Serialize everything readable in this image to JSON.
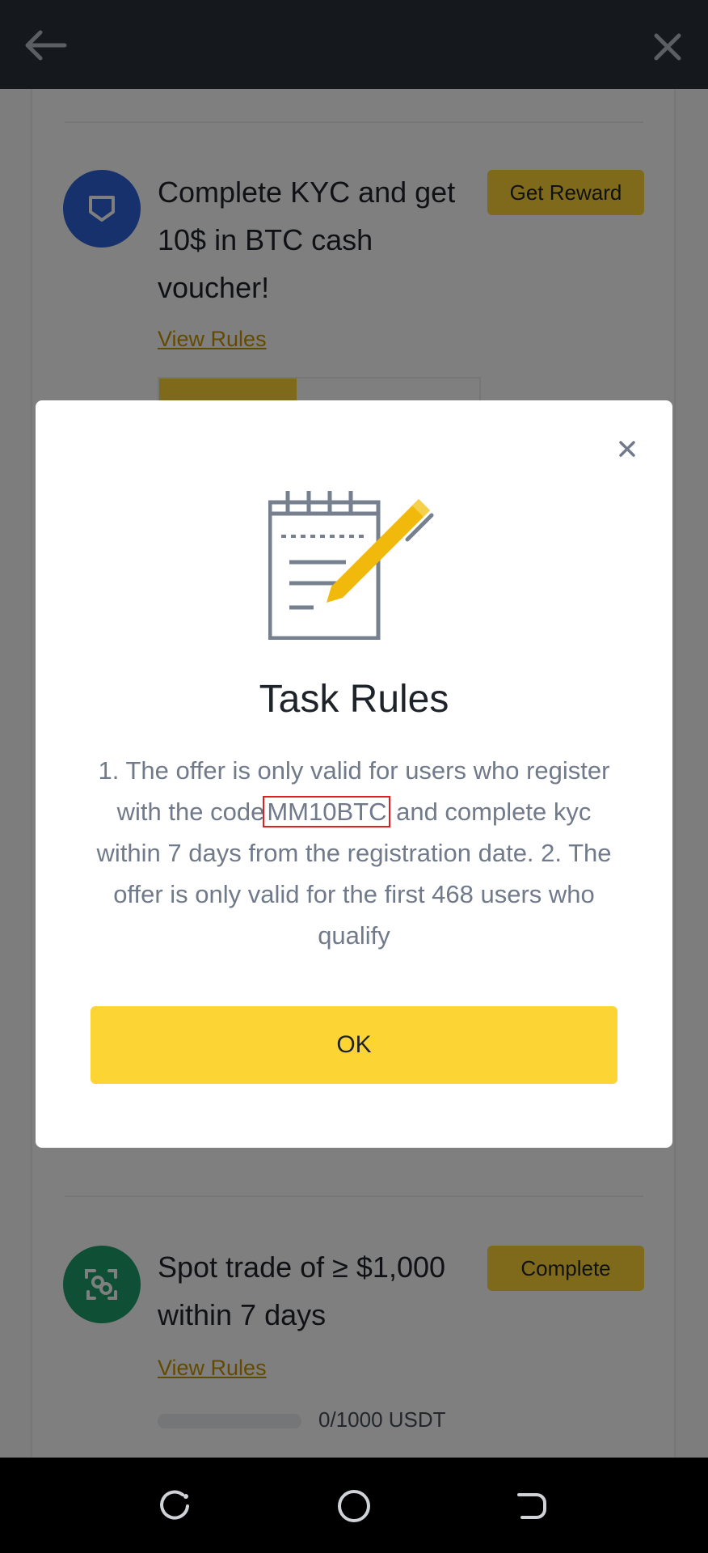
{
  "header": {
    "back_icon": "arrow-left-icon",
    "close_icon": "close-icon"
  },
  "tasks": [
    {
      "title": "Complete KYC and get 10$ in BTC cash voucher!",
      "button_label": "Get Reward",
      "view_rules_label": "View Rules",
      "icon": "shield-icon",
      "icon_color": "#2c63d6"
    },
    {
      "title": "Spot trade of ≥ $1,000 within 7 days",
      "button_label": "Complete",
      "view_rules_label": "View Rules",
      "icon": "trade-scan-icon",
      "icon_color": "#1f9e6c",
      "progress_text": "0/1000 USDT",
      "progress": 0
    }
  ],
  "modal": {
    "title": "Task Rules",
    "body_before": "1. The offer is only valid for users who register with the code",
    "code": "MM10BTC",
    "body_after": "and complete kyc  within 7 days from the registration date. 2. The offer is only valid for the first 468 users who qualify",
    "ok_label": "OK",
    "illustration": "notepad-pencil-icon"
  },
  "colors": {
    "accent": "#fcd535",
    "header_bg": "#2b3139",
    "link": "#c99400",
    "highlight_border": "#e02020"
  },
  "navbar": {
    "recents_icon": "recents-icon",
    "home_icon": "home-circle-icon",
    "back_icon": "back-nav-icon"
  }
}
